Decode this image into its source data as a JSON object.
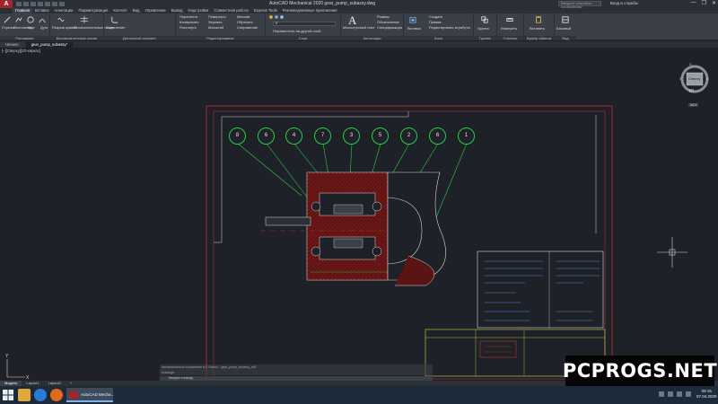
{
  "window": {
    "title": "AutoCAD Mechanical 2020   gear_pump_subassy.dwg",
    "search_placeholder": "Введите ключевое слово/фразу",
    "sign_in": "Вход в службы",
    "controls": [
      "—",
      "❐",
      "✕"
    ]
  },
  "ribbon_tabs": [
    "Главная",
    "Вставка",
    "Аннотации",
    "Параметризация",
    "Контент",
    "Вид",
    "Управление",
    "Вывод",
    "Надстройки",
    "Совместная работа",
    "Express Tools",
    "Рекомендованные приложения"
  ],
  "ribbon": {
    "draw": {
      "title": "Рисование",
      "items": [
        "Отрезок",
        "Полилиния",
        "Круг",
        "Дуга"
      ]
    },
    "construction": {
      "title": "Вспомогательные линии",
      "items": [
        "Разрыв кривой",
        "Вспомогательные линии"
      ]
    },
    "detail": {
      "title": "Детальный элемент",
      "items": [
        "Скругление"
      ]
    },
    "modify": {
      "title": "Редактирование",
      "items": [
        "Перенести",
        "Копировать",
        "Растянуть",
        "Повернуть",
        "Зеркало",
        "Масштаб",
        "Массив",
        "Обрезать",
        "Сопряжение"
      ]
    },
    "layers": {
      "title": "Слои",
      "layer_value": "0",
      "items": [
        "Переместить на другой слой"
      ]
    },
    "annotation": {
      "title": "Аннотации",
      "big": "A",
      "items": [
        "Многострочный текст",
        "Размер",
        "Обозначение",
        "Спецификация"
      ]
    },
    "block": {
      "title": "Блок",
      "items": [
        "Вставка",
        "Создать",
        "Правка",
        "Редактировать атрибуты"
      ]
    },
    "groups": {
      "title": "Группы",
      "items": [
        "Группа"
      ]
    },
    "utilities": {
      "title": "Утилиты",
      "items": [
        "Измерить"
      ]
    },
    "clipboard": {
      "title": "Буфер обмена",
      "items": [
        "Вставить"
      ]
    },
    "view": {
      "title": "Вид",
      "items": [
        "Базовый"
      ]
    }
  },
  "doc_tabs": [
    "Начало",
    "gear_pump_subassy*"
  ],
  "view_label": "[–][Сверху][2D-каркас]",
  "viewcube": {
    "label": "Сверху",
    "north": "С",
    "south": "Ю",
    "west": "З",
    "east": "В",
    "wcs": "МСК"
  },
  "drawing": {
    "balloons": [
      "8",
      "6",
      "4",
      "7",
      "3",
      "5",
      "2",
      "6",
      "1"
    ]
  },
  "command_line": {
    "history": "Автоматическое сохранение в C:\\Users\\...\\gear_pump_subassy_sv$",
    "prompt": "Команда:",
    "input_placeholder": "Введите команду"
  },
  "layout_tabs": [
    "Модель",
    "Layout1",
    "Layout2",
    "+"
  ],
  "taskbar": {
    "active_app": "AutoCAD Mecha...",
    "time": "09:15",
    "date": "07.04.2020"
  },
  "watermark": "PCPROGS.NET",
  "colors": {
    "canvas": "#1e2127",
    "drawing_frame": "#c0392b",
    "balloon": "#2ecc40",
    "hatch": "#8b1a1a",
    "title_block": "#d7d34a",
    "title_table": "#4a8fd4"
  }
}
